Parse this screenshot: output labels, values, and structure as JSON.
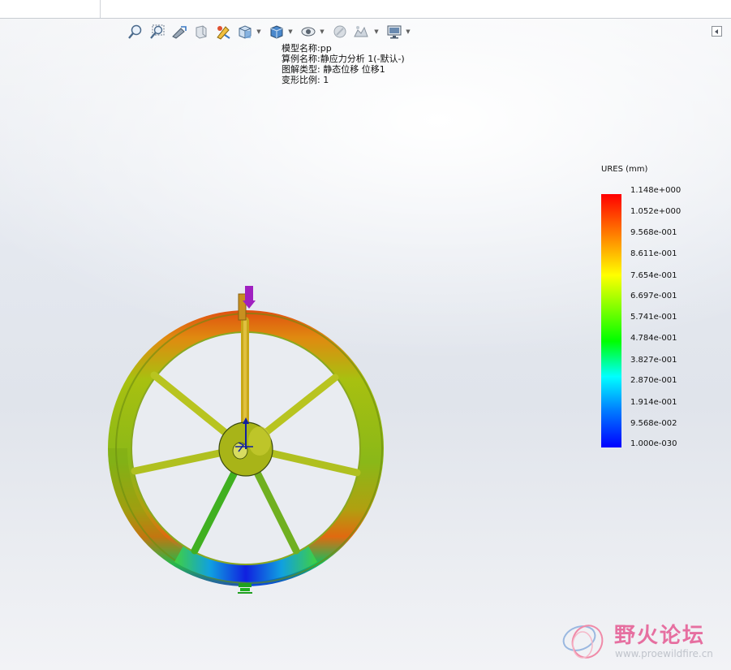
{
  "toolbar": {
    "buttons": [
      {
        "name": "zoom-to-fit-icon"
      },
      {
        "name": "zoom-to-area-icon"
      },
      {
        "name": "previous-view-icon"
      },
      {
        "name": "section-view-icon"
      },
      {
        "name": "dynamic-annotation-icon"
      },
      {
        "name": "view-orientation-icon"
      },
      {
        "name": "display-style-icon"
      },
      {
        "name": "hide-show-items-icon"
      },
      {
        "name": "edit-appearance-icon"
      },
      {
        "name": "apply-scene-icon"
      },
      {
        "name": "view-settings-icon"
      }
    ]
  },
  "info": {
    "model_name": "模型名称:pp",
    "study_name": "算例名称:静应力分析 1(-默认-)",
    "plot_type": "图解类型: 静态位移 位移1",
    "deformation_scale": "变形比例: 1"
  },
  "legend": {
    "title": "URES (mm)",
    "labels": [
      "1.148e+000",
      "1.052e+000",
      "9.568e-001",
      "8.611e-001",
      "7.654e-001",
      "6.697e-001",
      "5.741e-001",
      "4.784e-001",
      "3.827e-001",
      "2.870e-001",
      "1.914e-001",
      "9.568e-002",
      "1.000e-030"
    ],
    "colors": {
      "max": "#ff0000",
      "mid": "#00ff00",
      "min": "#0000ff"
    }
  },
  "watermark": {
    "title": "野火论坛",
    "url": "www.proewildfire.cn"
  }
}
